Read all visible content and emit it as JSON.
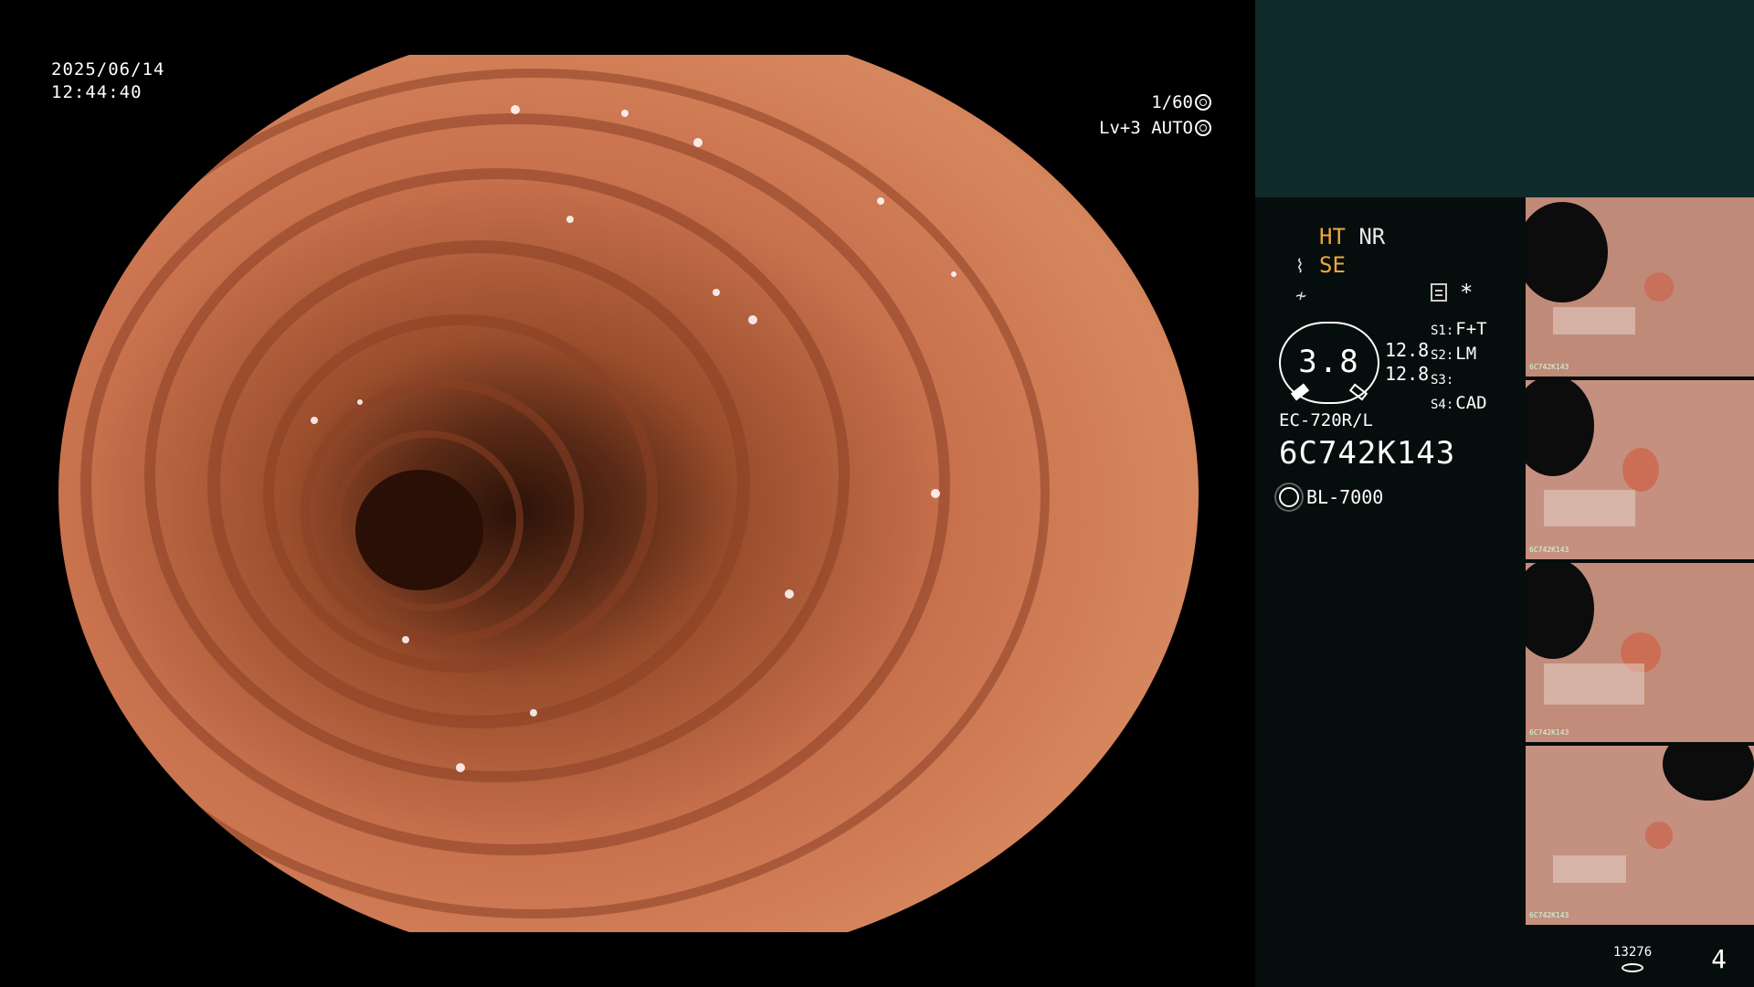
{
  "overlay": {
    "date": "2025/06/14",
    "time": "12:44:40",
    "shutter": "1/60",
    "level": "Lv+3",
    "exposure_mode": "AUTO"
  },
  "panel": {
    "modes": {
      "ht": "HT",
      "nr": "NR",
      "se": "SE"
    },
    "asterisk": "*",
    "gauge_value": "3.8",
    "gauge_top": "12.8",
    "gauge_bottom": "12.8",
    "settings": [
      {
        "key": "S1:",
        "value": "F+T"
      },
      {
        "key": "S2:",
        "value": "LM"
      },
      {
        "key": "S3:",
        "value": ""
      },
      {
        "key": "S4:",
        "value": "CAD"
      }
    ],
    "scope_model": "EC-720R/L",
    "scope_serial": "6C742K143",
    "light_source": "BL-7000",
    "thumbnails": [
      {
        "label": "6C742K143"
      },
      {
        "label": "6C742K143"
      },
      {
        "label": "6C742K143"
      },
      {
        "label": "6C742K143"
      }
    ],
    "storage_count": "13276",
    "image_count": "4"
  },
  "colors": {
    "background": "#000000",
    "panel_bg": "#060d0d",
    "panel_top_bg": "#0f2a2a",
    "mode_accent": "#f0a640",
    "mucosa": "#c8714d"
  }
}
